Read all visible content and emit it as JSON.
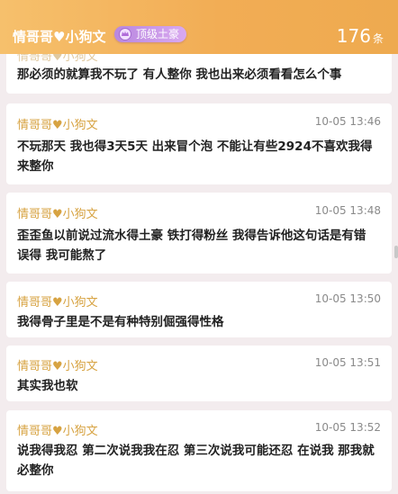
{
  "header": {
    "username": "情哥哥♥小狗文",
    "badge": "顶级土豪",
    "count": "176",
    "count_unit": "条"
  },
  "partial_header_text": "情哥哥♥小狗文",
  "comments": [
    {
      "text": "那必须的就算我不玩了 有人整你 我也出来必须看看怎么个事"
    },
    {
      "user": "情哥哥♥小狗文",
      "time": "10-05 13:46",
      "text": "不玩那天 我也得3天5天 出来冒个泡 不能让有些2924不喜欢我得 来整你"
    },
    {
      "user": "情哥哥♥小狗文",
      "time": "10-05 13:48",
      "text": "歪歪鱼以前说过流水得土豪 铁打得粉丝 我得告诉他这句话是有错误得 我可能熬了"
    },
    {
      "user": "情哥哥♥小狗文",
      "time": "10-05 13:50",
      "text": "我得骨子里是不是有种特别倔强得性格"
    },
    {
      "user": "情哥哥♥小狗文",
      "time": "10-05 13:51",
      "text": "其实我也软"
    },
    {
      "user": "情哥哥♥小狗文",
      "time": "10-05 13:52",
      "text": "说我得我忍 第二次说我我在忍 第三次说我可能还忍 在说我 那我就必整你"
    }
  ]
}
